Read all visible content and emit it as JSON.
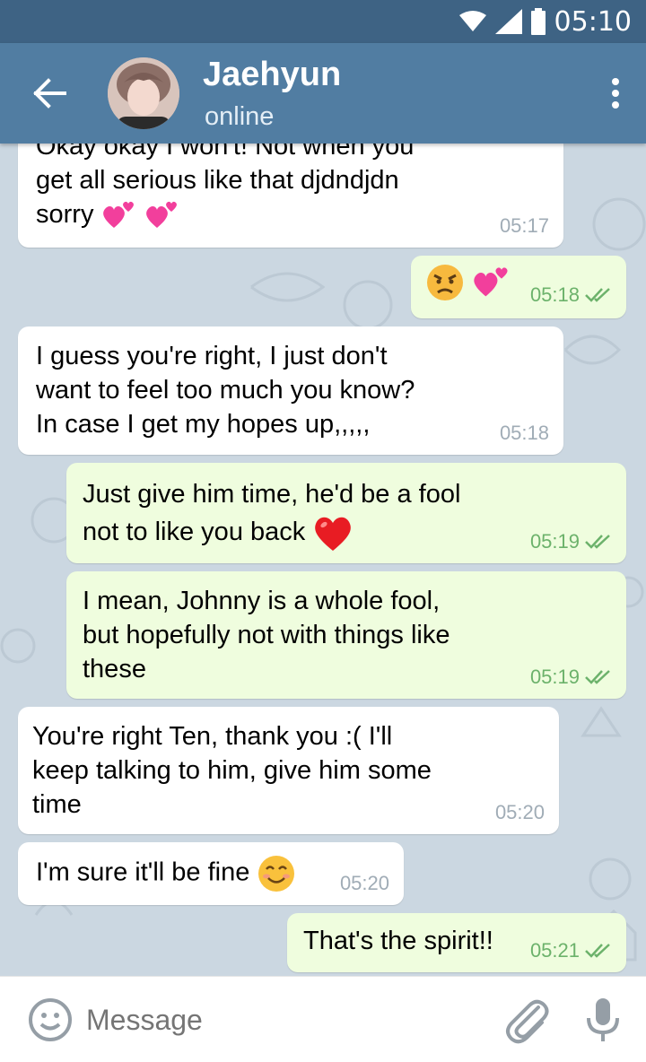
{
  "status_bar": {
    "time": "05:10"
  },
  "header": {
    "back_icon": "arrow-left-icon",
    "name": "Jaehyun",
    "status": "online",
    "menu_icon": "more-vertical-icon"
  },
  "messages": [
    {
      "dir": "in",
      "lines": [
        "Okay okay I won't! Not when you",
        "get all serious like that djdndjdn",
        "sorry"
      ],
      "emoji": [
        "two-hearts",
        "two-hearts"
      ],
      "time": "05:17"
    },
    {
      "dir": "out",
      "lines": [
        ""
      ],
      "emoji": [
        "angry-face",
        "two-hearts"
      ],
      "time": "05:18",
      "ticks": "double-check-icon"
    },
    {
      "dir": "in",
      "lines": [
        "I guess you're right, I just don't",
        "want to feel too much you know?",
        "In case I get my hopes up,,,,,"
      ],
      "time": "05:18"
    },
    {
      "dir": "out",
      "lines": [
        "Just give him time, he'd be a fool",
        "not to like you back"
      ],
      "emoji": [
        "red-heart"
      ],
      "time": "05:19",
      "ticks": "double-check-icon"
    },
    {
      "dir": "out",
      "lines": [
        "I mean, Johnny is a whole fool,",
        "but hopefully not with things like",
        "these"
      ],
      "time": "05:19",
      "ticks": "double-check-icon"
    },
    {
      "dir": "in",
      "lines": [
        "You're right Ten, thank you :( I'll",
        "keep talking to him, give him some",
        "time"
      ],
      "time": "05:20"
    },
    {
      "dir": "in",
      "lines": [
        "I'm sure it'll be fine"
      ],
      "emoji": [
        "smiling-face"
      ],
      "time": "05:20"
    },
    {
      "dir": "out",
      "lines": [
        "That's the spirit!!"
      ],
      "time": "05:21",
      "ticks": "double-check-icon"
    }
  ],
  "input": {
    "placeholder": "Message"
  },
  "colors": {
    "header": "#517da2",
    "statusbar": "#3e6384",
    "incoming": "#ffffff",
    "outgoing": "#effdde",
    "tick": "#6cb26b"
  }
}
